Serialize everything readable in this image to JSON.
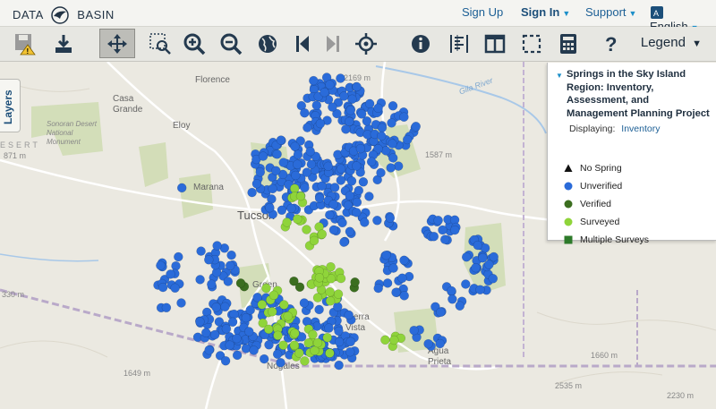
{
  "header": {
    "logo_left": "DATA",
    "logo_right": "BASIN",
    "nav": {
      "sign_up": "Sign Up",
      "sign_in": "Sign In",
      "support": "Support",
      "language": "English"
    }
  },
  "toolbar": {
    "legend_label": "Legend"
  },
  "layers_tab": "Layers",
  "legend": {
    "title": "Springs in the Sky Island Region: Inventory, Assessment, and Management Planning Project",
    "displaying_label": "Displaying:",
    "displaying_value": "Inventory",
    "items": [
      {
        "label": "No Spring",
        "symbol": "triangle",
        "color": "#111111"
      },
      {
        "label": "Unverified",
        "symbol": "circle",
        "color": "#2a6bd9"
      },
      {
        "label": "Verified",
        "symbol": "circle",
        "color": "#3b6e1f"
      },
      {
        "label": "Surveyed",
        "symbol": "circle",
        "color": "#8fd43a"
      },
      {
        "label": "Multiple Surveys",
        "symbol": "square",
        "color": "#2d7a2a"
      }
    ]
  },
  "map": {
    "place_labels": {
      "florence": "Florence",
      "casa_grande": "Casa Grande",
      "eloy": "Eloy",
      "marana": "Marana",
      "tucson": "Tucson",
      "sonoran": "Sonoran Desert National Monument",
      "desert": "ESERT",
      "sierra_vista": "Sierra Vista",
      "agua_prieta": "Agua Prieta",
      "green_valley": "Green",
      "nogales": "Nogales",
      "gila_river": "Gila River"
    },
    "elevations": [
      "2169 m",
      "1587 m",
      "871 m",
      "330 m",
      "1649 m",
      "1660 m",
      "2535 m",
      "2230 m"
    ],
    "colors": {
      "unverified": "#2a6bd9",
      "surveyed": "#8fd43a",
      "verified": "#3b6e1f",
      "parkland": "#c8d8a8"
    }
  }
}
